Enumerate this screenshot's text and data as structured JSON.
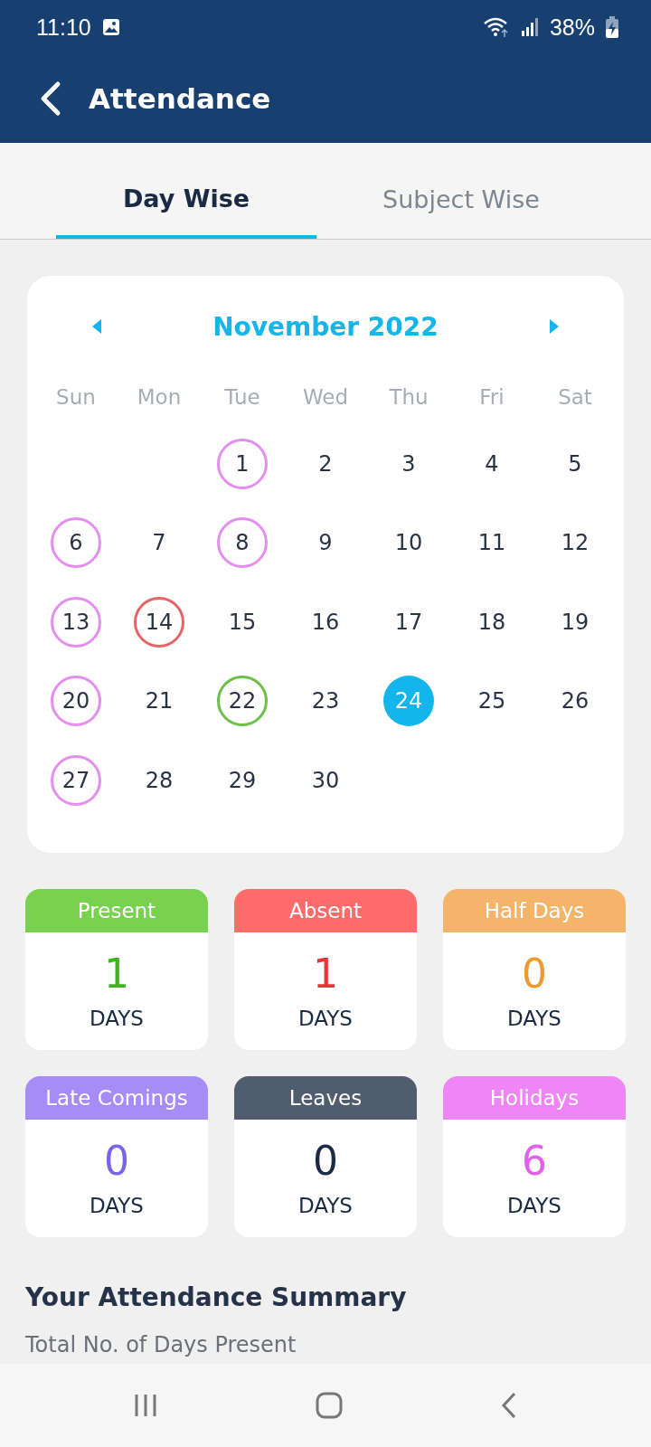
{
  "status_bar": {
    "time": "11:10",
    "battery": "38%"
  },
  "app_bar": {
    "title": "Attendance"
  },
  "tabs": [
    {
      "label": "Day Wise",
      "selected": true
    },
    {
      "label": "Subject Wise",
      "selected": false
    }
  ],
  "calendar": {
    "month": "November 2022",
    "weekdays": [
      "Sun",
      "Mon",
      "Tue",
      "Wed",
      "Thu",
      "Fri",
      "Sat"
    ],
    "cells": [
      {
        "kind": "empty"
      },
      {
        "kind": "empty"
      },
      {
        "kind": "holiday",
        "day": "1"
      },
      {
        "kind": "day",
        "day": "2"
      },
      {
        "kind": "day",
        "day": "3"
      },
      {
        "kind": "day",
        "day": "4"
      },
      {
        "kind": "day",
        "day": "5"
      },
      {
        "kind": "holiday",
        "day": "6"
      },
      {
        "kind": "day",
        "day": "7"
      },
      {
        "kind": "holiday",
        "day": "8"
      },
      {
        "kind": "day",
        "day": "9"
      },
      {
        "kind": "day",
        "day": "10"
      },
      {
        "kind": "day",
        "day": "11"
      },
      {
        "kind": "day",
        "day": "12"
      },
      {
        "kind": "holiday",
        "day": "13"
      },
      {
        "kind": "absent",
        "day": "14"
      },
      {
        "kind": "day",
        "day": "15"
      },
      {
        "kind": "day",
        "day": "16"
      },
      {
        "kind": "day",
        "day": "17"
      },
      {
        "kind": "day",
        "day": "18"
      },
      {
        "kind": "day",
        "day": "19"
      },
      {
        "kind": "holiday",
        "day": "20"
      },
      {
        "kind": "day",
        "day": "21"
      },
      {
        "kind": "present",
        "day": "22"
      },
      {
        "kind": "day",
        "day": "23"
      },
      {
        "kind": "today",
        "day": "24"
      },
      {
        "kind": "day",
        "day": "25"
      },
      {
        "kind": "day",
        "day": "26"
      },
      {
        "kind": "holiday",
        "day": "27"
      },
      {
        "kind": "day",
        "day": "28"
      },
      {
        "kind": "day",
        "day": "29"
      },
      {
        "kind": "day",
        "day": "30"
      }
    ]
  },
  "stats": [
    {
      "kind": "present",
      "label": "Present",
      "value": "1",
      "unit": "DAYS",
      "color": "#78d14f"
    },
    {
      "kind": "absent",
      "label": "Absent",
      "value": "1",
      "unit": "DAYS",
      "color": "#fd6b6b"
    },
    {
      "kind": "half",
      "label": "Half Days",
      "value": "0",
      "unit": "DAYS",
      "color": "#f4b46a"
    },
    {
      "kind": "late",
      "label": "Late Comings",
      "value": "0",
      "unit": "DAYS",
      "color": "#a68cf7"
    },
    {
      "kind": "leave",
      "label": "Leaves",
      "value": "0",
      "unit": "DAYS",
      "color": "#4f5d6e"
    },
    {
      "kind": "holiday",
      "label": "Holidays",
      "value": "6",
      "unit": "DAYS",
      "color": "#ef86f6"
    }
  ],
  "summary": {
    "title": "Your Attendance Summary",
    "rows": [
      "Total No. of Days Present"
    ]
  }
}
